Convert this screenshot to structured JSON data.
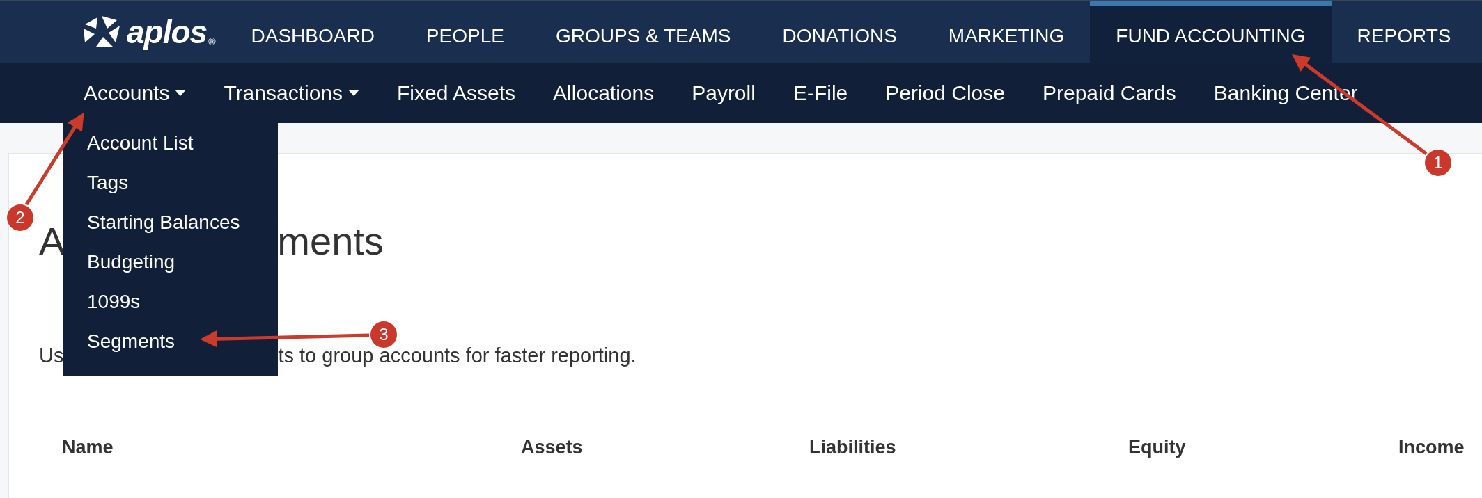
{
  "brand": {
    "name": "aplos",
    "mark": "®"
  },
  "main_nav": [
    {
      "label": "DASHBOARD",
      "selected": false
    },
    {
      "label": "PEOPLE",
      "selected": false
    },
    {
      "label": "GROUPS & TEAMS",
      "selected": false
    },
    {
      "label": "DONATIONS",
      "selected": false
    },
    {
      "label": "MARKETING",
      "selected": false
    },
    {
      "label": "FUND ACCOUNTING",
      "selected": true
    },
    {
      "label": "REPORTS",
      "selected": false
    }
  ],
  "sub_nav": [
    {
      "label": "Accounts",
      "has_menu": true
    },
    {
      "label": "Transactions",
      "has_menu": true
    },
    {
      "label": "Fixed Assets",
      "has_menu": false
    },
    {
      "label": "Allocations",
      "has_menu": false
    },
    {
      "label": "Payroll",
      "has_menu": false
    },
    {
      "label": "E-File",
      "has_menu": false
    },
    {
      "label": "Period Close",
      "has_menu": false
    },
    {
      "label": "Prepaid Cards",
      "has_menu": false
    },
    {
      "label": "Banking Center",
      "has_menu": false
    }
  ],
  "dropdown": {
    "items": [
      "Account List",
      "Tags",
      "Starting Balances",
      "Budgeting",
      "1099s",
      "Segments"
    ]
  },
  "page": {
    "heading_start": "A",
    "heading_end": "ments",
    "description_start": "Us",
    "description_end": "ts to group accounts for faster reporting.",
    "table": {
      "columns": [
        "Name",
        "Assets",
        "Liabilities",
        "Equity",
        "Income"
      ]
    }
  },
  "annotations": [
    {
      "number": "1"
    },
    {
      "number": "2"
    },
    {
      "number": "3"
    }
  ]
}
